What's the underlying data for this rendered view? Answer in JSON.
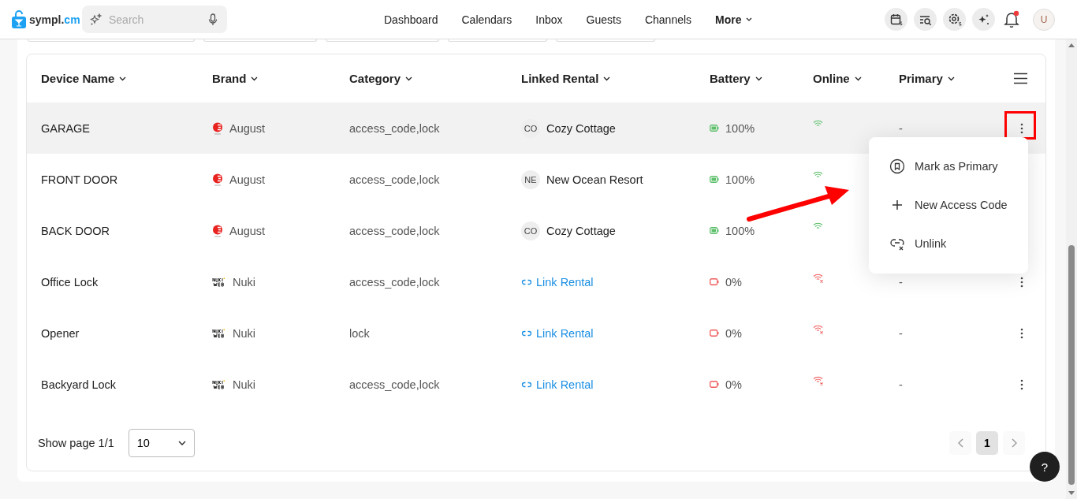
{
  "brand": {
    "name": "sympl.",
    "suffix": "cm"
  },
  "search": {
    "placeholder": "Search"
  },
  "nav": [
    {
      "label": "Dashboard",
      "kind": "link"
    },
    {
      "label": "Calendars",
      "kind": "link"
    },
    {
      "label": "Inbox",
      "kind": "link"
    },
    {
      "label": "Guests",
      "kind": "link"
    },
    {
      "label": "Channels",
      "kind": "link"
    },
    {
      "label": "More",
      "kind": "dropdown"
    }
  ],
  "notifications": {
    "unread": true
  },
  "avatar": {
    "initial": "U"
  },
  "table": {
    "columns": [
      {
        "label": "Device Name"
      },
      {
        "label": "Brand"
      },
      {
        "label": "Category"
      },
      {
        "label": "Linked Rental"
      },
      {
        "label": "Battery"
      },
      {
        "label": "Online"
      },
      {
        "label": "Primary"
      }
    ],
    "rows": [
      {
        "name": "GARAGE",
        "brand": {
          "name": "August",
          "kind": "august"
        },
        "category": "access_code,lock",
        "rental": {
          "kind": "linked",
          "initials": "CO",
          "name": "Cozy Cottage"
        },
        "battery": {
          "kind": "full",
          "text": "100%"
        },
        "online": true,
        "primary": "-",
        "highlighted": true,
        "menu_open": true
      },
      {
        "name": "FRONT DOOR",
        "brand": {
          "name": "August",
          "kind": "august"
        },
        "category": "access_code,lock",
        "rental": {
          "kind": "linked",
          "initials": "NE",
          "name": "New Ocean Resort"
        },
        "battery": {
          "kind": "full",
          "text": "100%"
        },
        "online": true,
        "primary": "",
        "highlighted": false,
        "menu_open": false
      },
      {
        "name": "BACK DOOR",
        "brand": {
          "name": "August",
          "kind": "august"
        },
        "category": "access_code,lock",
        "rental": {
          "kind": "linked",
          "initials": "CO",
          "name": "Cozy Cottage"
        },
        "battery": {
          "kind": "full",
          "text": "100%"
        },
        "online": true,
        "primary": "",
        "highlighted": false,
        "menu_open": false
      },
      {
        "name": "Office Lock",
        "brand": {
          "name": "Nuki",
          "kind": "nuki"
        },
        "category": "access_code,lock",
        "rental": {
          "kind": "link",
          "name": "Link Rental"
        },
        "battery": {
          "kind": "empty",
          "text": "0%"
        },
        "online": false,
        "primary": "-",
        "highlighted": false,
        "menu_open": false
      },
      {
        "name": "Opener",
        "brand": {
          "name": "Nuki",
          "kind": "nuki"
        },
        "category": "lock",
        "rental": {
          "kind": "link",
          "name": "Link Rental"
        },
        "battery": {
          "kind": "empty",
          "text": "0%"
        },
        "online": false,
        "primary": "-",
        "highlighted": false,
        "menu_open": false
      },
      {
        "name": "Backyard Lock",
        "brand": {
          "name": "Nuki",
          "kind": "nuki"
        },
        "category": "access_code,lock",
        "rental": {
          "kind": "link",
          "name": "Link Rental"
        },
        "battery": {
          "kind": "empty",
          "text": "0%"
        },
        "online": false,
        "primary": "-",
        "highlighted": false,
        "menu_open": false
      }
    ]
  },
  "row_menu": [
    {
      "label": "Mark as Primary",
      "kind": "primary"
    },
    {
      "label": "New Access Code",
      "kind": "add"
    },
    {
      "label": "Unlink",
      "kind": "unlink"
    }
  ],
  "pagination": {
    "label": "Show page 1/1",
    "page_size": "10",
    "pages": [
      {
        "label": "1",
        "selected": true
      }
    ]
  },
  "help": {
    "label": "?"
  }
}
